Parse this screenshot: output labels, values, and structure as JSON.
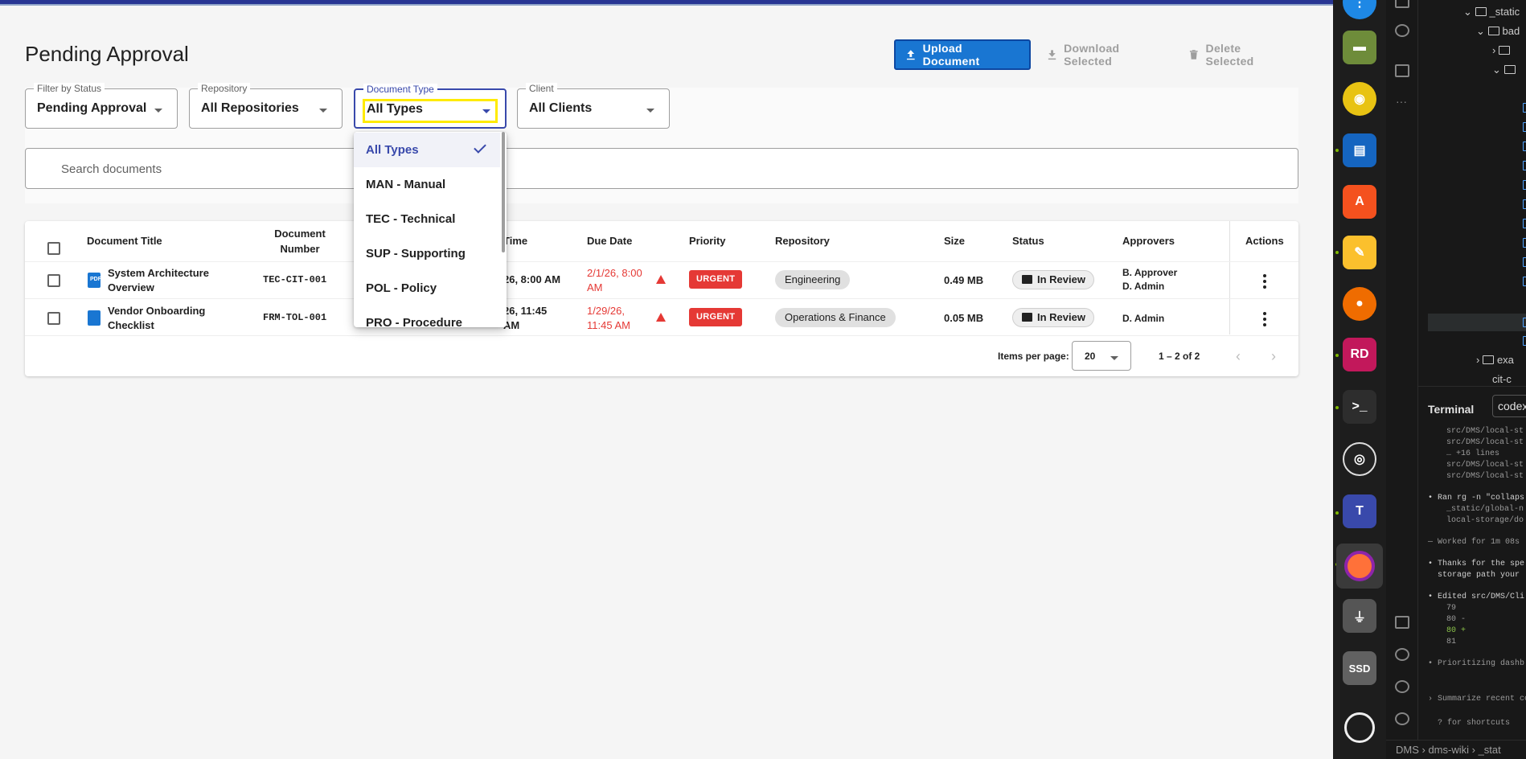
{
  "page": {
    "title": "Pending Approval",
    "actions": {
      "upload": "Upload Document",
      "download": "Download Selected",
      "delete": "Delete Selected"
    }
  },
  "filters": {
    "status": {
      "label": "Filter by Status",
      "value": "Pending Approval"
    },
    "repository": {
      "label": "Repository",
      "value": "All Repositories"
    },
    "doc_type": {
      "label": "Document Type",
      "value": "All Types"
    },
    "client": {
      "label": "Client",
      "value": "All Clients"
    },
    "search_placeholder": "Search documents"
  },
  "doc_type_menu": {
    "options": [
      "All Types",
      "MAN - Manual",
      "TEC - Technical",
      "SUP - Supporting",
      "POL - Policy",
      "PRO - Procedure"
    ],
    "selected": "All Types"
  },
  "table": {
    "headers": {
      "title": "Document Title",
      "number": "Document Number",
      "time": "Time",
      "due": "Due Date",
      "priority": "Priority",
      "repository": "Repository",
      "size": "Size",
      "status": "Status",
      "approvers": "Approvers",
      "actions": "Actions"
    },
    "rows": [
      {
        "title": "System Architecture Overview",
        "icon": "pdf-icon",
        "number": "TEC-CIT-001",
        "time": "26, 8:00 AM",
        "due": "2/1/26, 8:00 AM",
        "priority": "URGENT",
        "repository": "Engineering",
        "size": "0.49 MB",
        "status": "In Review",
        "approvers": [
          "B. Approver",
          "D. Admin"
        ]
      },
      {
        "title": "Vendor Onboarding Checklist",
        "icon": "doc-icon",
        "number": "FRM-TOL-001",
        "time": "26, 11:45 AM",
        "due": "1/29/26, 11:45 AM",
        "priority": "URGENT",
        "repository": "Operations & Finance",
        "size": "0.05 MB",
        "status": "In Review",
        "approvers": [
          "D. Admin"
        ]
      }
    ]
  },
  "pagination": {
    "label": "Items per page:",
    "per_page": "20",
    "range": "1 – 2 of 2"
  },
  "ide": {
    "tree": [
      "_static",
      "bad",
      "exa",
      "cit-c"
    ],
    "terminal_title": "Terminal",
    "terminal_tab": "codex",
    "terminal_lines": [
      "src/DMS/local-st",
      "src/DMS/local-st",
      "… +16 lines",
      "src/DMS/local-st",
      "src/DMS/local-st",
      "• Ran rg -n \"collaps",
      "_static/global-n",
      "local-storage/do",
      "— Worked for 1m 08s",
      "• Thanks for the spe",
      "storage path your",
      "• Edited src/DMS/Cli",
      "79",
      "80 -",
      "80 +",
      "81",
      "• Prioritizing dashb",
      "› Summarize recent co",
      "? for shortcuts"
    ],
    "breadcrumb": [
      "DMS",
      "dms-wiki",
      "_stat"
    ]
  },
  "colors": {
    "primary": "#1976d2",
    "accent": "#3949ab",
    "urgent": "#e53935",
    "highlight": "#ffeb00"
  }
}
